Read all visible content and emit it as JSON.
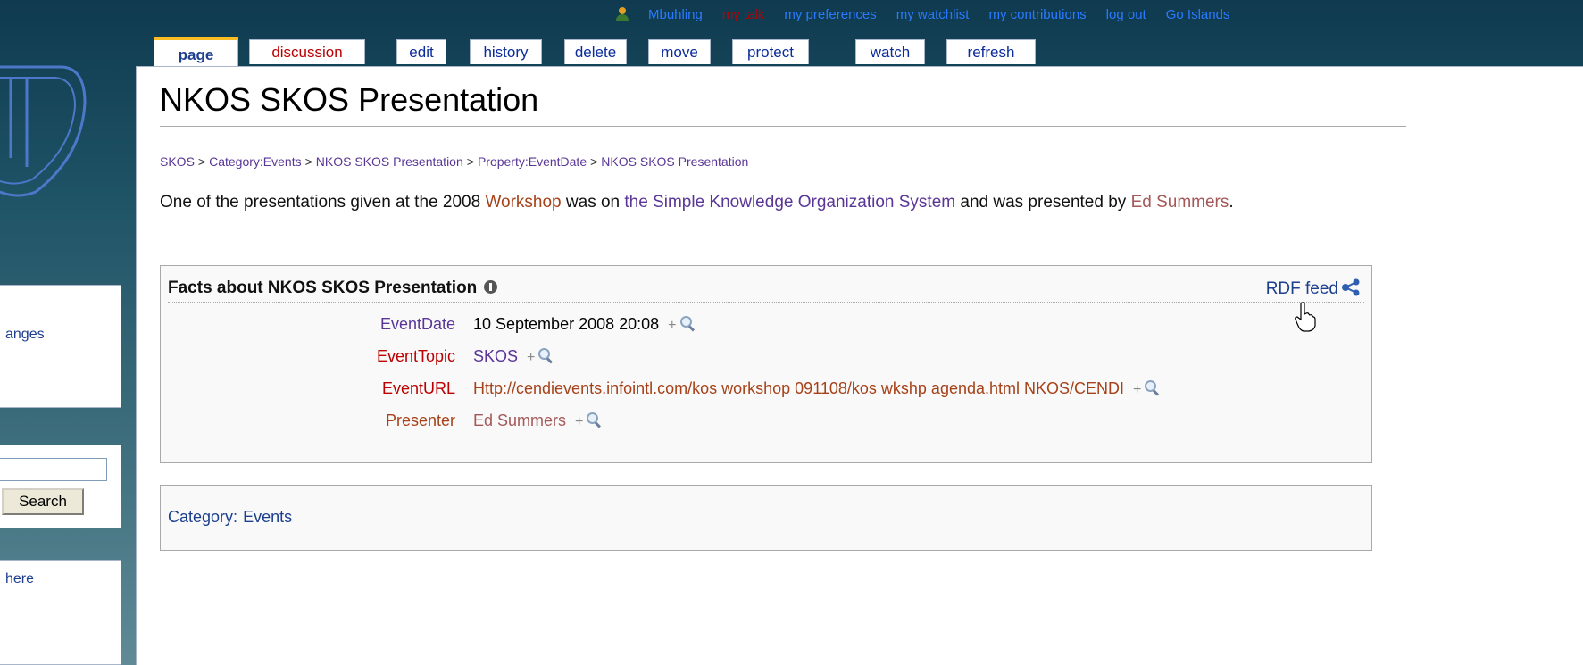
{
  "personal_bar": [
    "Mbuhling",
    "my talk",
    "my preferences",
    "my watchlist",
    "my contributions",
    "log out",
    "Go Islands"
  ],
  "tabs": [
    {
      "label": "page",
      "selected": true
    },
    {
      "label": "discussion",
      "new": true
    },
    {
      "label": "edit"
    },
    {
      "label": "history"
    },
    {
      "label": "delete"
    },
    {
      "label": "move"
    },
    {
      "label": "protect"
    },
    {
      "label": "watch"
    },
    {
      "label": "refresh"
    }
  ],
  "page_title": "NKOS SKOS Presentation",
  "breadcrumb": [
    "SKOS",
    "Category:Events",
    "NKOS SKOS Presentation",
    "Property:EventDate",
    "NKOS SKOS Presentation"
  ],
  "breadcrumb_sep": ">",
  "intro": {
    "t1": "One of the presentations given at the 2008 ",
    "link1": "Workshop",
    "t2": " was on ",
    "link2": "the Simple Knowledge Organization System",
    "t3": " and was presented by ",
    "link3": "Ed Summers",
    "t4": "."
  },
  "facts": {
    "title": "Facts about NKOS SKOS Presentation",
    "rdf_feed": "RDF feed",
    "plus": "+",
    "rows": [
      {
        "property": "EventDate",
        "value": "10 September 2008 20:08"
      },
      {
        "property": "EventTopic",
        "value": "SKOS"
      },
      {
        "property": "EventURL",
        "value": "Http://cendievents.infointl.com/kos workshop 091108/kos wkshp agenda.html NKOS/CENDI"
      },
      {
        "property": "Presenter",
        "value": "Ed Summers"
      }
    ]
  },
  "categories": {
    "label": "Category",
    "colon": ":",
    "item": "Events"
  },
  "sidebar": {
    "item_changes": "anges",
    "search_button": "Search",
    "item_here": "here"
  },
  "colors": {
    "link": "#5a3696",
    "new_link": "#ba0000",
    "tab_selected": "#fabd23"
  }
}
